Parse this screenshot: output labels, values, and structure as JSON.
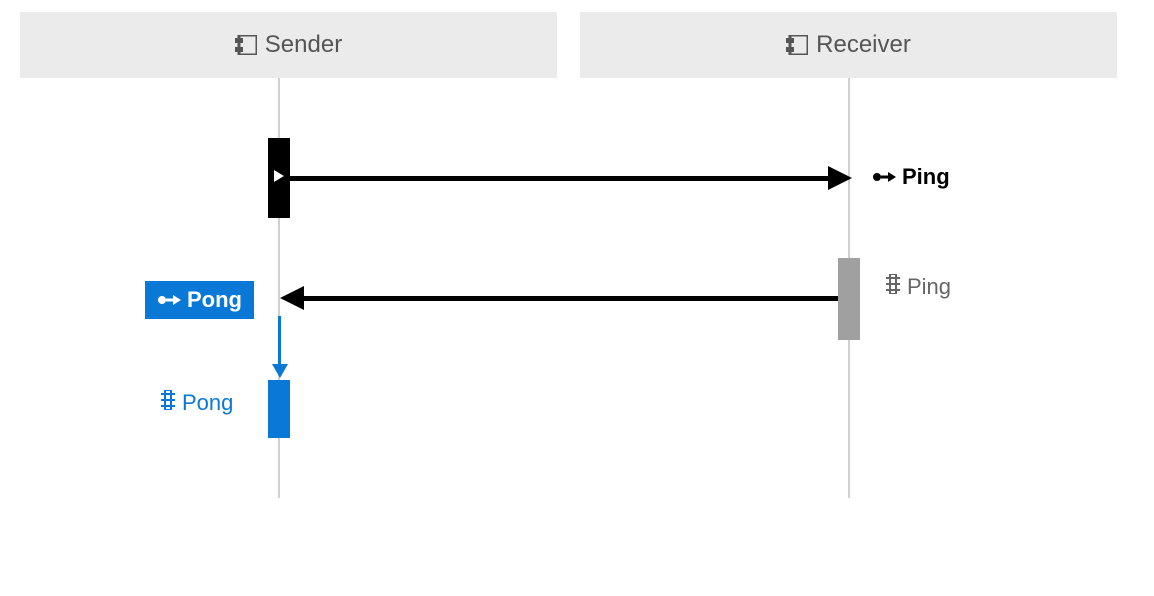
{
  "lifelines": {
    "sender": {
      "label": "Sender"
    },
    "receiver": {
      "label": "Receiver"
    }
  },
  "messages": {
    "ping_send": {
      "label": "Ping"
    },
    "ping_recv": {
      "label": "Ping"
    },
    "pong_send": {
      "label": "Pong"
    },
    "pong_recv": {
      "label": "Pong"
    }
  },
  "colors": {
    "blue": "#0a78d6",
    "gray": "#a0a0a0",
    "header_bg": "#ebebeb",
    "text_gray": "#666"
  }
}
